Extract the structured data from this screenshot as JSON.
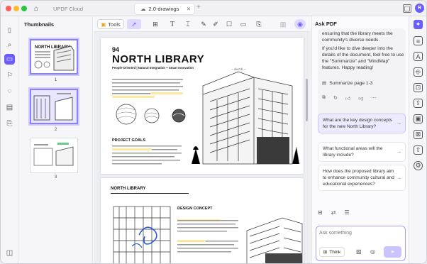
{
  "titlebar": {
    "colors": {
      "close": "#ff5f57",
      "minimize": "#febc2e",
      "maximize": "#28c840"
    },
    "tabs": [
      {
        "label": "UPDF Cloud",
        "active": false
      },
      {
        "label": "2.0-drawings",
        "active": true
      }
    ],
    "new_tab": "+",
    "avatar": "R"
  },
  "toolbar": {
    "tools_label": "Tools"
  },
  "sidebar": {
    "title": "Thumbnails",
    "pages": [
      "1",
      "2",
      "3"
    ]
  },
  "document": {
    "page1": {
      "number": "94",
      "title": "NORTH LIBRARY",
      "subtitle": "People-Oriented | Natural Integration + Smart Innovation",
      "section": "PROJECT GOALS"
    },
    "page2": {
      "heading": "NORTH LIBRARY",
      "section": "DESIGN CONCEPT"
    }
  },
  "ask_pdf": {
    "title": "Ask PDF",
    "message_top": "ensuring that the library meets the community's diverse needs.",
    "message_body": "If you'd like to dive deeper into the details of the document, feel free to use the \"Summarize\" and \"MindMap\" features. Happy reading!",
    "summarize_label": "Summarize page 1-3",
    "suggestions": [
      "What are the key design concepts for the new North Library?",
      "What functional areas will the library include?",
      "How does the proposed library aim to enhance community cultural and educational experiences?"
    ],
    "input_placeholder": "Ask something",
    "think_label": "Think",
    "accent": "#6a5cff"
  }
}
